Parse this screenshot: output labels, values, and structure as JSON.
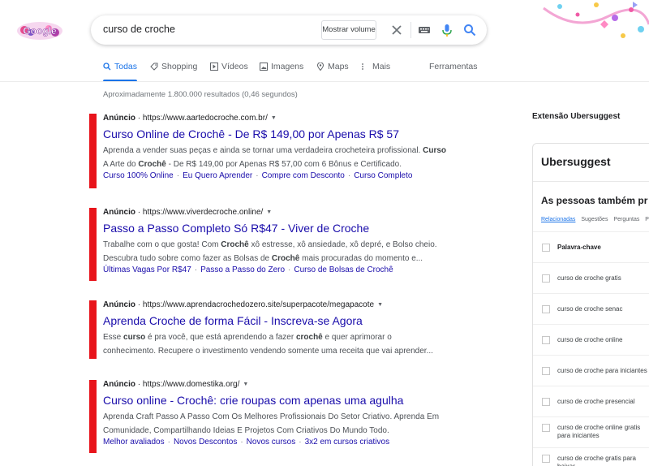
{
  "header": {
    "logo_text": "Google",
    "query": "curso de croche",
    "volume_button": "Mostrar volume"
  },
  "tabs": [
    {
      "label": "Todas",
      "icon": "search-icon",
      "active": true
    },
    {
      "label": "Shopping",
      "icon": "tag-icon",
      "active": false
    },
    {
      "label": "Vídeos",
      "icon": "play-icon",
      "active": false
    },
    {
      "label": "Imagens",
      "icon": "image-icon",
      "active": false
    },
    {
      "label": "Maps",
      "icon": "pin-icon",
      "active": false
    },
    {
      "label": "Mais",
      "icon": "more-dots-icon",
      "active": false
    }
  ],
  "tools_label": "Ferramentas",
  "stats": "Aproximadamente 1.800.000 resultados (0,46 segundos)",
  "ads": [
    {
      "label": "Anúncio",
      "url": "https://www.aartedocroche.com.br/",
      "title": "Curso Online de Crochê - De R$ 149,00 por Apenas R$ 57",
      "desc_line1": "Aprenda a vender suas peças e ainda se tornar uma verdadeira crocheteira profissional.",
      "desc_line1_bold": "Curso",
      "desc_line2_a": "A Arte do",
      "desc_line2_bold": "Crochê",
      "desc_line2_b": "- De R$ 149,00 por Apenas R$ 57,00 com 6 Bônus e Certificado.",
      "links": [
        "Curso 100% Online",
        "Eu Quero Aprender",
        "Compre com Desconto",
        "Curso Completo"
      ]
    },
    {
      "label": "Anúncio",
      "url": "https://www.viverdecroche.online/",
      "title": "Passo a Passo Completo Só R$47 - Viver de Croche",
      "desc_line1_a": "Trabalhe com o que gosta! Com",
      "desc_line1_bold": "Crochê",
      "desc_line1_b": "xô estresse, xô ansiedade, xô depré, e Bolso cheio.",
      "desc_line2_a": "Descubra tudo sobre como fazer as Bolsas de",
      "desc_line2_bold": "Crochê",
      "desc_line2_b": "mais procuradas do momento e...",
      "links": [
        "Últimas Vagas Por R$47",
        "Passo a Passo do Zero",
        "Curso de Bolsas de Crochê"
      ]
    },
    {
      "label": "Anúncio",
      "url": "https://www.aprendacrochedozero.site/superpacote/megapacote",
      "title": "Aprenda Croche de forma Fácil - Inscreva-se Agora",
      "desc_line1_a": "Esse",
      "desc_line1_bold1": "curso",
      "desc_line1_b": "é pra você, que está aprendendo a fazer",
      "desc_line1_bold2": "crochê",
      "desc_line1_c": "e quer aprimorar o",
      "desc_line2": "conhecimento. Recupere o investimento vendendo somente uma receita que vai aprender..."
    },
    {
      "label": "Anúncio",
      "url": "https://www.domestika.org/",
      "title": "Curso online - Crochê: crie roupas com apenas uma agulha",
      "desc_line1": "Aprenda Craft Passo A Passo Com Os Melhores Profissionais Do Setor Criativo. Aprenda Em",
      "desc_line2": "Comunidade, Compartilhando Ideias E Projetos Com Criativos Do Mundo Todo.",
      "links": [
        "Melhor avaliados",
        "Novos Descontos",
        "Novos cursos",
        "3x2 em cursos criativos"
      ]
    }
  ],
  "sidebar": {
    "extension_title": "Extensão Ubersuggest",
    "brand": "Ubersuggest",
    "heading": "As pessoas também pr",
    "tabs": [
      "Relacionadas",
      "Sugestões",
      "Perguntas",
      "Pr"
    ],
    "keyword_header": "Palavra-chave",
    "keywords": [
      "curso de croche gratis",
      "curso de croche senac",
      "curso de croche online",
      "curso de croche para iniciantes",
      "curso de croche presencial",
      "curso de croche online gratis para iniciantes",
      "curso de croche gratis para baixar"
    ]
  },
  "colors": {
    "link": "#1a0dab",
    "accent": "#1a73e8",
    "ad_marker": "#e8141b"
  }
}
